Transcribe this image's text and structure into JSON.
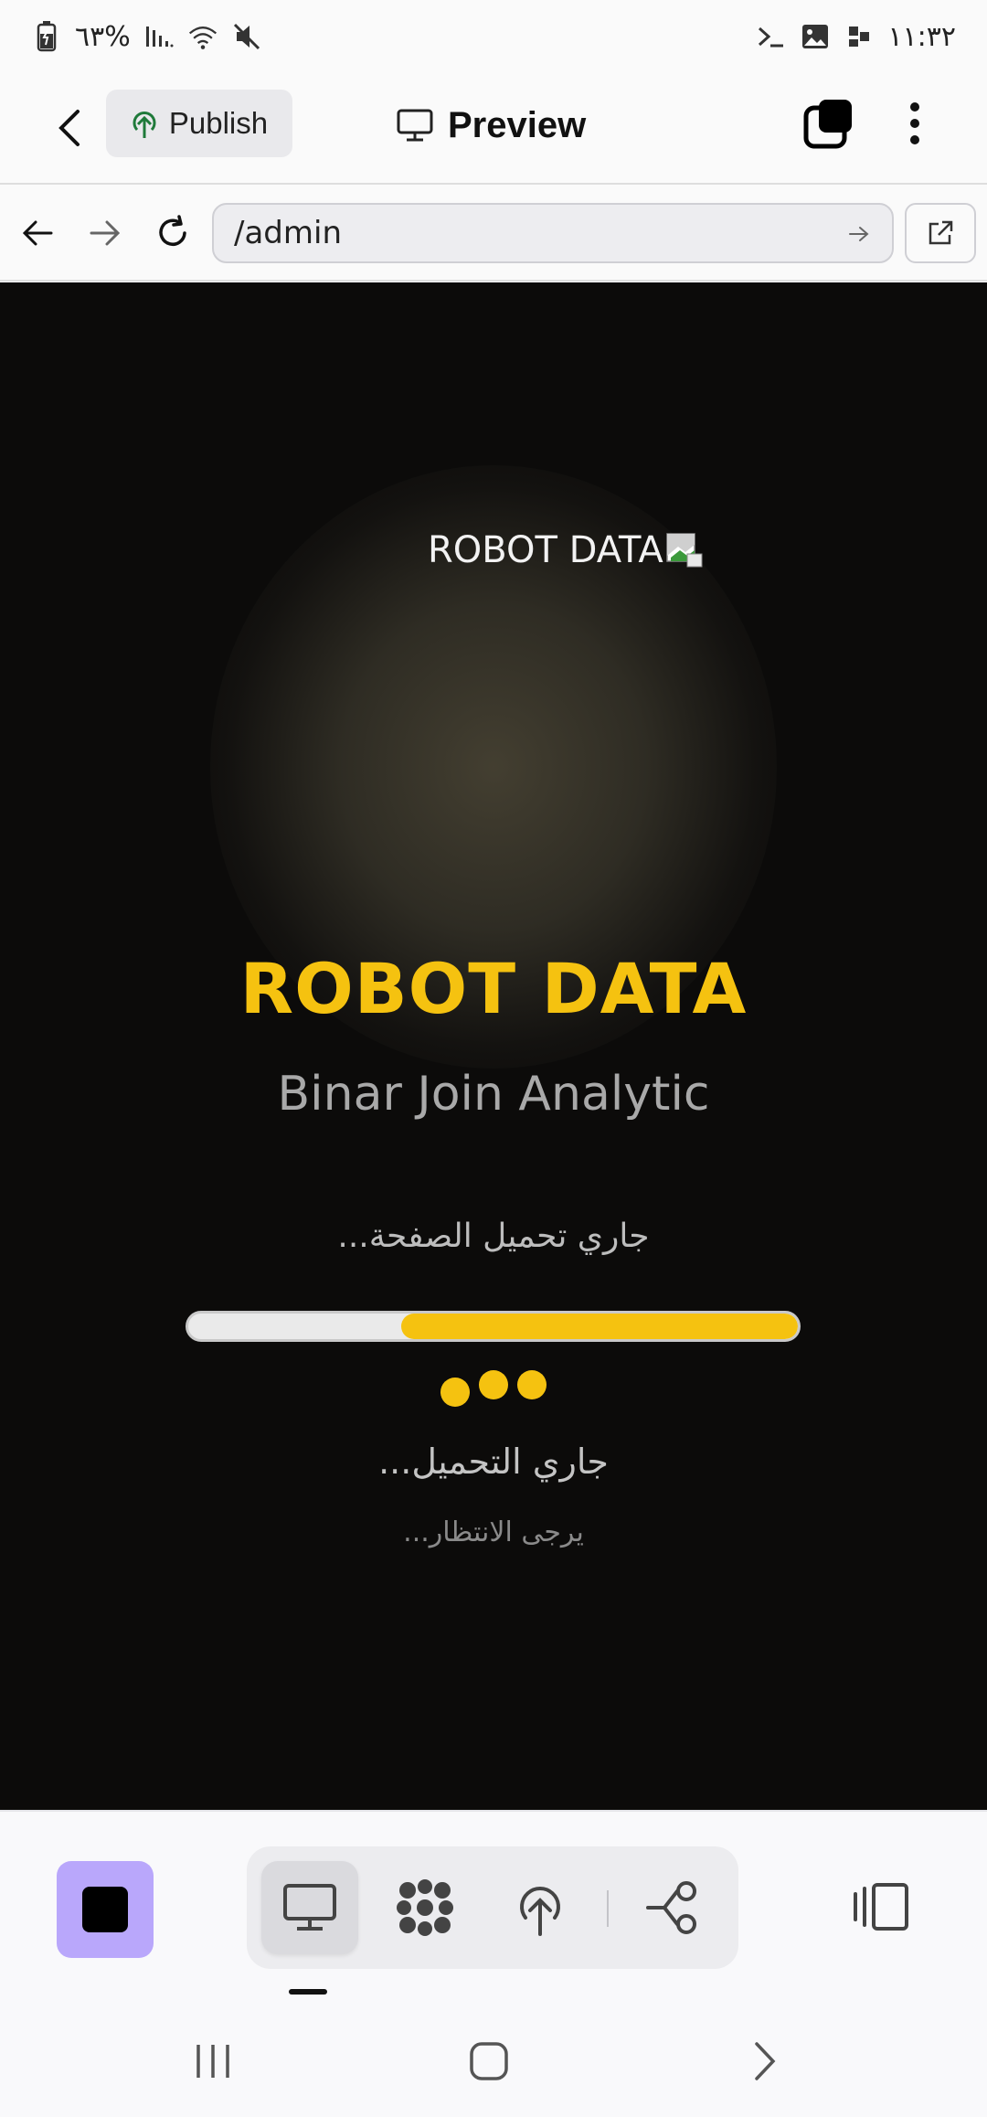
{
  "status_bar": {
    "battery_text": "٦٣%",
    "time": "١١:٣٢"
  },
  "toolbar": {
    "publish_label": "Publish",
    "preview_label": "Preview"
  },
  "address_bar": {
    "url": "/admin"
  },
  "page": {
    "logo_alt": "ROBOT DATA",
    "brand_title": "ROBOT DATA",
    "brand_subtitle": "Binar Join Analytic",
    "loading_page_text": "جاري تحميل الصفحة...",
    "progress_fraction": 0.65,
    "loading_text": "جاري التحميل...",
    "wait_text": "يرجى الانتظار...",
    "accent_color": "#f5c210",
    "background_color": "#0c0b0a"
  },
  "bottom_bar": {
    "modes": [
      "monitor-icon",
      "grid-icon",
      "deploy-icon",
      "flow-icon"
    ],
    "active_mode": "monitor-icon",
    "stop_button_color": "#b9a7fb"
  }
}
